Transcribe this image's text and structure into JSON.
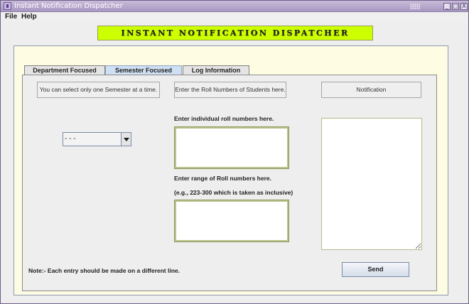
{
  "window": {
    "title": "Instant Notification Dispatcher",
    "controls": {
      "minimize": "_",
      "maximize": "□",
      "close": "X"
    }
  },
  "menu": {
    "file": "File",
    "help": "Help"
  },
  "banner": {
    "text": "INSTANT NOTIFICATION DISPATCHER"
  },
  "tabs": [
    {
      "label": "Department Focused",
      "active": false
    },
    {
      "label": "Semester Focused",
      "active": true
    },
    {
      "label": "Log Information",
      "active": false
    }
  ],
  "semester": {
    "hint": "You can select only one Semester at a time.",
    "selected": "- - -"
  },
  "roll_numbers": {
    "hint": "Enter the Roll Numbers of Students here.",
    "individual_prompt": "Enter individual roll numbers here.",
    "individual_value": "",
    "range_prompt": "Enter range of Roll numbers here.",
    "range_example": "(e.g., 223-300  which is taken as inclusive)",
    "range_value": ""
  },
  "notification": {
    "label": "Notification",
    "value": ""
  },
  "note": "Note:- Each entry should be made on a different line.",
  "send_label": "Send",
  "colors": {
    "banner_bg": "#ccff00",
    "panel_bg": "#fefde3",
    "active_tab": "#cfe0f3",
    "title_bar": "#a897c2"
  }
}
